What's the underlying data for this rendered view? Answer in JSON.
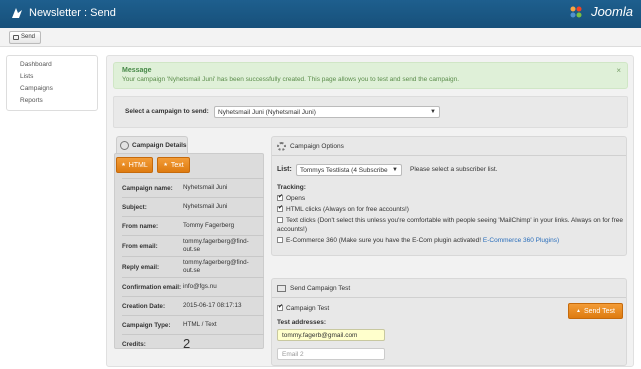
{
  "header": {
    "title": "Newsletter : Send",
    "brand": "Joomla",
    "logo_icon": "joomla-logo-icon"
  },
  "toolbar": {
    "send_label": "Send"
  },
  "sidebar": {
    "items": [
      {
        "label": "Dashboard"
      },
      {
        "label": "Lists"
      },
      {
        "label": "Campaigns"
      },
      {
        "label": "Reports"
      }
    ]
  },
  "alert": {
    "heading": "Message",
    "text": "Your campaign 'Nyhetsmail Juni' has been successfully created. This page allows you to test and send the campaign.",
    "close": "×"
  },
  "campaign_select": {
    "label": "Select a campaign to send:",
    "value": "Nyhetsmail Juni (Nyhetsmail Juni)"
  },
  "details": {
    "tab_label": "Campaign Details",
    "html_button": "HTML",
    "text_button": "Text",
    "rows": [
      {
        "key": "Campaign name:",
        "value": "Nyhetsmail Juni"
      },
      {
        "key": "Subject:",
        "value": "Nyhetsmail Juni"
      },
      {
        "key": "From name:",
        "value": "Tommy Fagerberg"
      },
      {
        "key": "From email:",
        "value": "tommy.fagerberg@find-out.se"
      },
      {
        "key": "Reply email:",
        "value": "tommy.fagerberg@find-out.se"
      },
      {
        "key": "Confirmation email:",
        "value": "info@fgs.nu"
      },
      {
        "key": "Creation Date:",
        "value": "2015-06-17 08:17:13"
      },
      {
        "key": "Campaign Type:",
        "value": "HTML / Text"
      },
      {
        "key": "Credits:",
        "value": "2"
      }
    ]
  },
  "options": {
    "title": "Campaign Options",
    "list_label": "List:",
    "list_value": "Tommys Testlista (4 Subscribe",
    "list_hint": "Please select a subscriber list.",
    "tracking_label": "Tracking:",
    "opens": {
      "label": "Opens",
      "checked": true
    },
    "html_clicks": {
      "label": "HTML clicks (Always on for free accounts!)",
      "checked": true
    },
    "text_clicks": {
      "label": "Text clicks (Don't select this unless you're comfortable with people seeing 'MailChimp' in your links. Always on for free accounts!)",
      "checked": false
    },
    "ecommerce": {
      "label": "E-Commerce 360 (Make sure you have the E-Com plugin activated!",
      "link": "E-Commerce 360 Plugins)",
      "checked": false
    }
  },
  "test": {
    "title": "Send Campaign Test",
    "campaign_test": {
      "label": "Campaign Test",
      "checked": true
    },
    "send_test_label": "Send Test",
    "addresses_label": "Test addresses:",
    "email1_value": "tommy.fagerb@gmail.com",
    "email2_placeholder": "Email 2"
  }
}
